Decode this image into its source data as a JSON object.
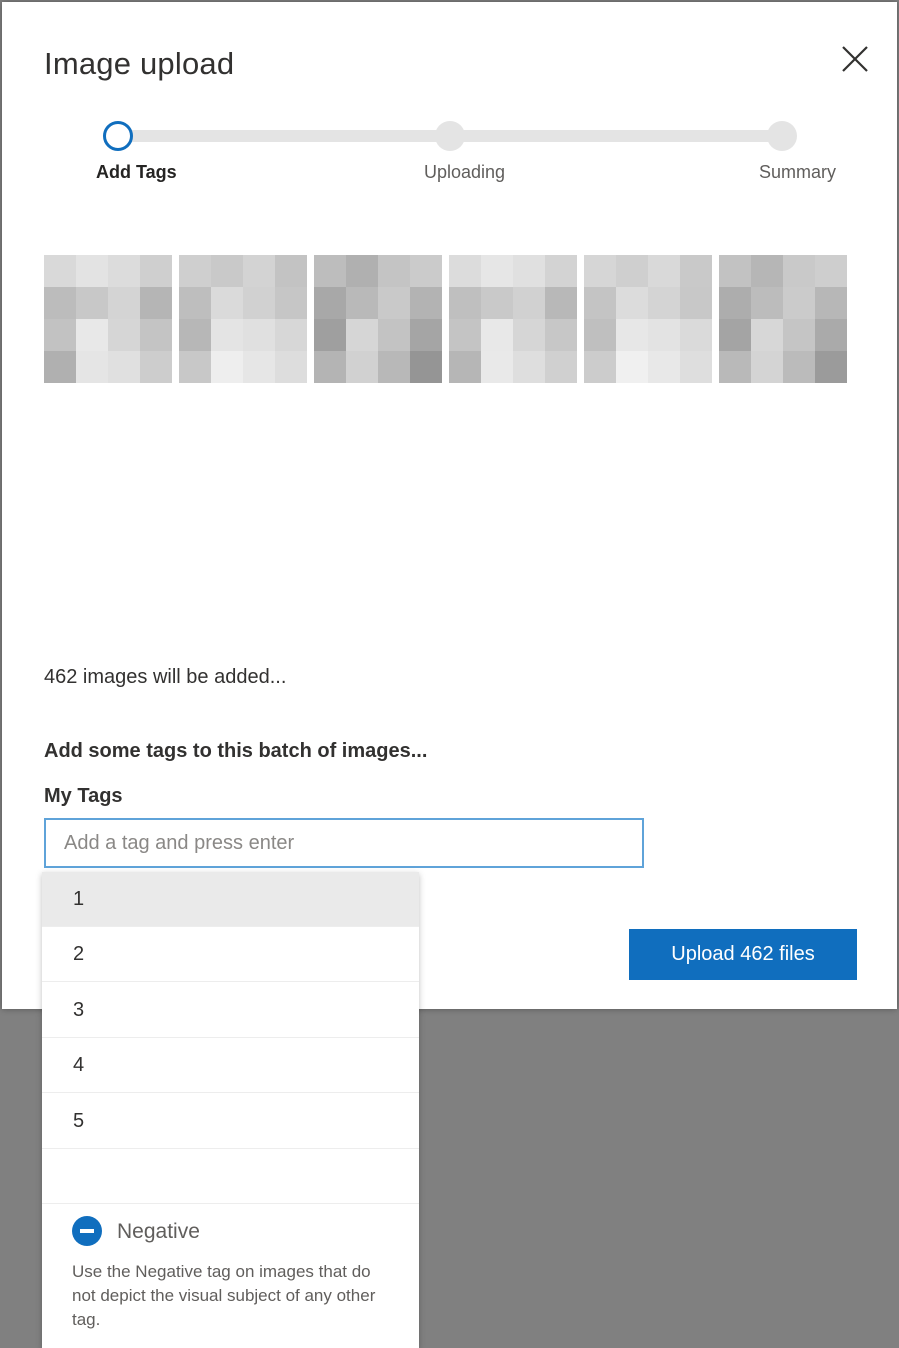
{
  "dialog": {
    "title": "Image upload",
    "close_icon": "close-icon"
  },
  "stepper": {
    "steps": [
      {
        "label": "Add Tags",
        "state": "active"
      },
      {
        "label": "Uploading",
        "state": "pending"
      },
      {
        "label": "Summary",
        "state": "pending"
      }
    ]
  },
  "thumbnails": {
    "count_shown": 6,
    "palettes": [
      [
        "#d9d9d9",
        "#e3e3e3",
        "#dcdcdc",
        "#cfcfcf",
        "#bcbcbc",
        "#c8c8c8",
        "#d4d4d4",
        "#b5b5b5",
        "#c2c2c2",
        "#e8e8e8",
        "#d6d6d6",
        "#c4c4c4",
        "#b0b0b0",
        "#e5e5e5",
        "#e0e0e0",
        "#cdcdcd"
      ],
      [
        "#cfcfcf",
        "#c9c9c9",
        "#d3d3d3",
        "#c3c3c3",
        "#bebebe",
        "#dadada",
        "#d1d1d1",
        "#c6c6c6",
        "#b7b7b7",
        "#e4e4e4",
        "#e0e0e0",
        "#d7d7d7",
        "#c8c8c8",
        "#eeeeee",
        "#e6e6e6",
        "#dddddd"
      ],
      [
        "#bdbdbd",
        "#b0b0b0",
        "#c4c4c4",
        "#cbcbcb",
        "#a8a8a8",
        "#b9b9b9",
        "#c9c9c9",
        "#b3b3b3",
        "#9f9f9f",
        "#d6d6d6",
        "#c3c3c3",
        "#a5a5a5",
        "#b4b4b4",
        "#d1d1d1",
        "#b8b8b8",
        "#959595"
      ],
      [
        "#dcdcdc",
        "#e6e6e6",
        "#e0e0e0",
        "#d3d3d3",
        "#bfbfbf",
        "#c9c9c9",
        "#d1d1d1",
        "#b8b8b8",
        "#c4c4c4",
        "#e8e8e8",
        "#d6d6d6",
        "#c7c7c7",
        "#b6b6b6",
        "#e9e9e9",
        "#dedede",
        "#d0d0d0"
      ],
      [
        "#d6d6d6",
        "#cfcfcf",
        "#d9d9d9",
        "#c9c9c9",
        "#c4c4c4",
        "#dcdcdc",
        "#d4d4d4",
        "#c8c8c8",
        "#bfbfbf",
        "#e7e7e7",
        "#e3e3e3",
        "#dadada",
        "#cccccc",
        "#f0f0f0",
        "#e8e8e8",
        "#dedede"
      ],
      [
        "#c2c2c2",
        "#b6b6b6",
        "#c9c9c9",
        "#cecece",
        "#adadad",
        "#bcbcbc",
        "#cbcbcb",
        "#b7b7b7",
        "#a4a4a4",
        "#d7d7d7",
        "#c5c5c5",
        "#aaaaaa",
        "#b9b9b9",
        "#d4d4d4",
        "#bbbbbb",
        "#9b9b9b"
      ]
    ]
  },
  "summary": {
    "count_text": "462 images will be added...",
    "batch_heading": "Add some tags to this batch of images...",
    "tags_label": "My Tags"
  },
  "tag_input": {
    "value": "",
    "placeholder": "Add a tag and press enter"
  },
  "dropdown": {
    "options": [
      "1",
      "2",
      "3",
      "4",
      "5",
      ""
    ],
    "highlighted_index": 0,
    "negative": {
      "label": "Negative",
      "description": "Use the Negative tag on images that do not depict the visual subject of any other tag."
    }
  },
  "actions": {
    "upload_label": "Upload 462 files"
  },
  "colors": {
    "accent": "#106ebe",
    "backdrop": "#808080",
    "step_track": "#e4e4e4"
  }
}
